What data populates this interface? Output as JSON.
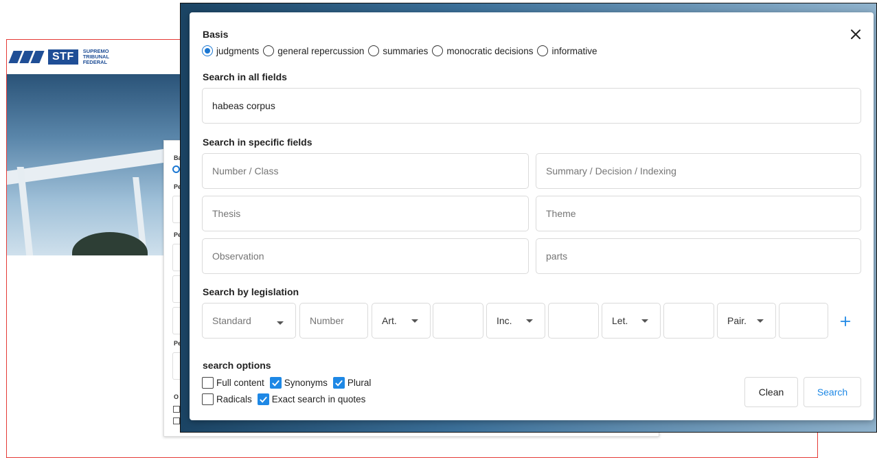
{
  "background": {
    "logo_abbr": "STF",
    "logo_line1": "SUPREMO",
    "logo_line2": "TRIBUNAL",
    "logo_line3": "FEDERAL",
    "card_labels": [
      "Ba",
      "Pe",
      "Pe",
      "Pe",
      "O"
    ]
  },
  "modal": {
    "basis_label": "Basis",
    "basis_options": [
      "judgments",
      "general repercussion",
      "summaries",
      "monocratic decisions",
      "informative"
    ],
    "basis_selected": 0,
    "all_fields_label": "Search in all fields",
    "all_fields_value": "habeas corpus",
    "specific_label": "Search in specific fields",
    "specific_fields": {
      "number_class": "Number / Class",
      "summary_decision": "Summary / Decision / Indexing",
      "thesis": "Thesis",
      "theme": "Theme",
      "observation": "Observation",
      "parts": "parts"
    },
    "legislation_label": "Search by legislation",
    "legislation": {
      "standard": "Standard",
      "number": "Number",
      "art": "Art.",
      "inc": "Inc.",
      "let": "Let.",
      "pair": "Pair."
    },
    "options_label": "search options",
    "options": {
      "full_content": {
        "label": "Full content",
        "checked": false
      },
      "synonyms": {
        "label": "Synonyms",
        "checked": true
      },
      "plural": {
        "label": "Plural",
        "checked": true
      },
      "radicals": {
        "label": "Radicals",
        "checked": false
      },
      "exact_quotes": {
        "label": "Exact search in quotes",
        "checked": true
      }
    },
    "clean_label": "Clean",
    "search_label": "Search"
  },
  "colors": {
    "accent": "#1976d2",
    "check": "#1e88e5",
    "frame": "#e53935",
    "logo": "#1f4e96"
  },
  "icons": {
    "close": "close-icon",
    "add": "plus-icon",
    "dropdown": "chevron-down-icon"
  }
}
